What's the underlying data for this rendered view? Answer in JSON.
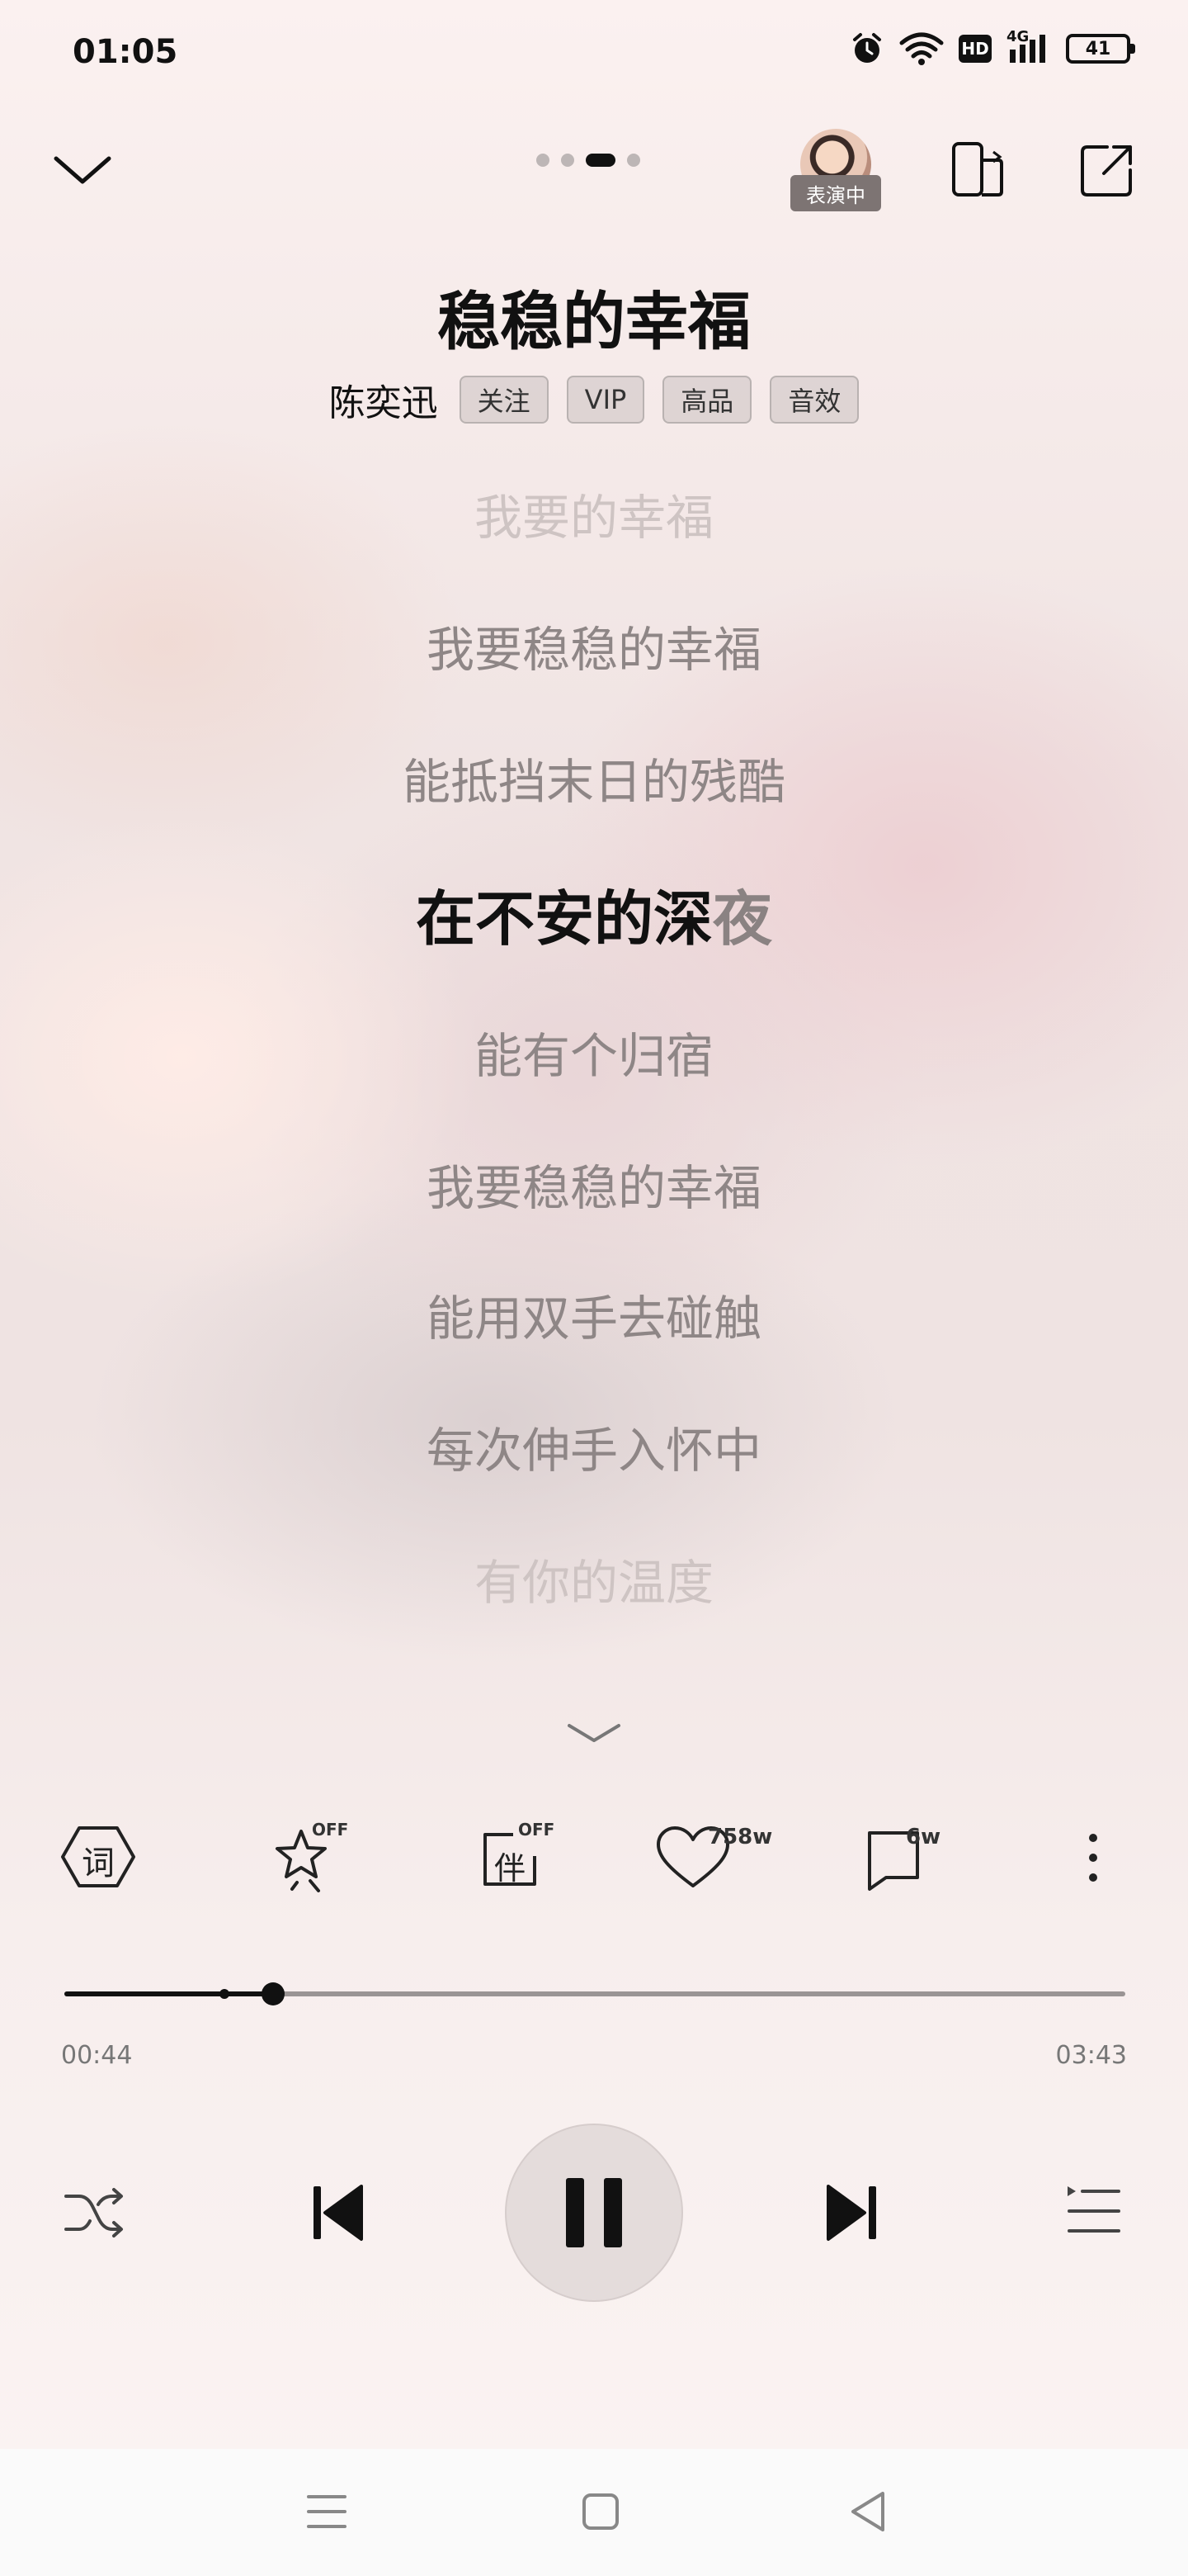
{
  "status_bar": {
    "time": "01:05",
    "network": "4G",
    "hd_label": "HD",
    "battery": "41",
    "icons": [
      "alarm-icon",
      "wifi-icon",
      "hd-icon",
      "signal-4g-icon",
      "battery-icon"
    ]
  },
  "header": {
    "collapse_icon": "chevron-down-icon",
    "pager": {
      "count": 4,
      "active_index": 2
    },
    "live_badge": "表演中",
    "icons": [
      "avatar",
      "device-switch-icon",
      "share-icon"
    ]
  },
  "song": {
    "title": "稳稳的幸福",
    "artist": "陈奕迅",
    "tags": [
      "关注",
      "VIP",
      "高品",
      "音效"
    ]
  },
  "lyrics": {
    "lines": [
      "我要的幸福",
      "我要稳稳的幸福",
      "能抵挡末日的残酷",
      "在不安的深夜",
      "能有个归宿",
      "我要稳稳的幸福",
      "能用双手去碰触",
      "每次伸手入怀中",
      "有你的温度"
    ],
    "current_index": 3,
    "current_sung": "在不安的深",
    "current_unsung": "夜"
  },
  "actions": {
    "lyrics_icon_label": "词",
    "effects_off": "OFF",
    "accompany_label": "伴",
    "accompany_off": "OFF",
    "like_count": "758w",
    "comment_count": "6w",
    "icons": [
      "lyrics-icon",
      "star-effect-icon",
      "accompany-icon",
      "heart-icon",
      "comment-icon",
      "more-icon"
    ]
  },
  "progress": {
    "elapsed": "00:44",
    "total": "03:43",
    "played_fraction": 0.197,
    "buffered_fraction": 0.151
  },
  "controls": {
    "icons": [
      "shuffle-icon",
      "previous-icon",
      "pause-icon",
      "next-icon",
      "playlist-icon"
    ],
    "state": "playing"
  },
  "navbar": {
    "icons": [
      "menu-nav-icon",
      "home-nav-icon",
      "back-nav-icon"
    ]
  },
  "colors": {
    "text_primary": "#111111",
    "lyric_dim": "#8e8686",
    "lyric_faded": "#cec4c3",
    "accent": "#111111"
  }
}
